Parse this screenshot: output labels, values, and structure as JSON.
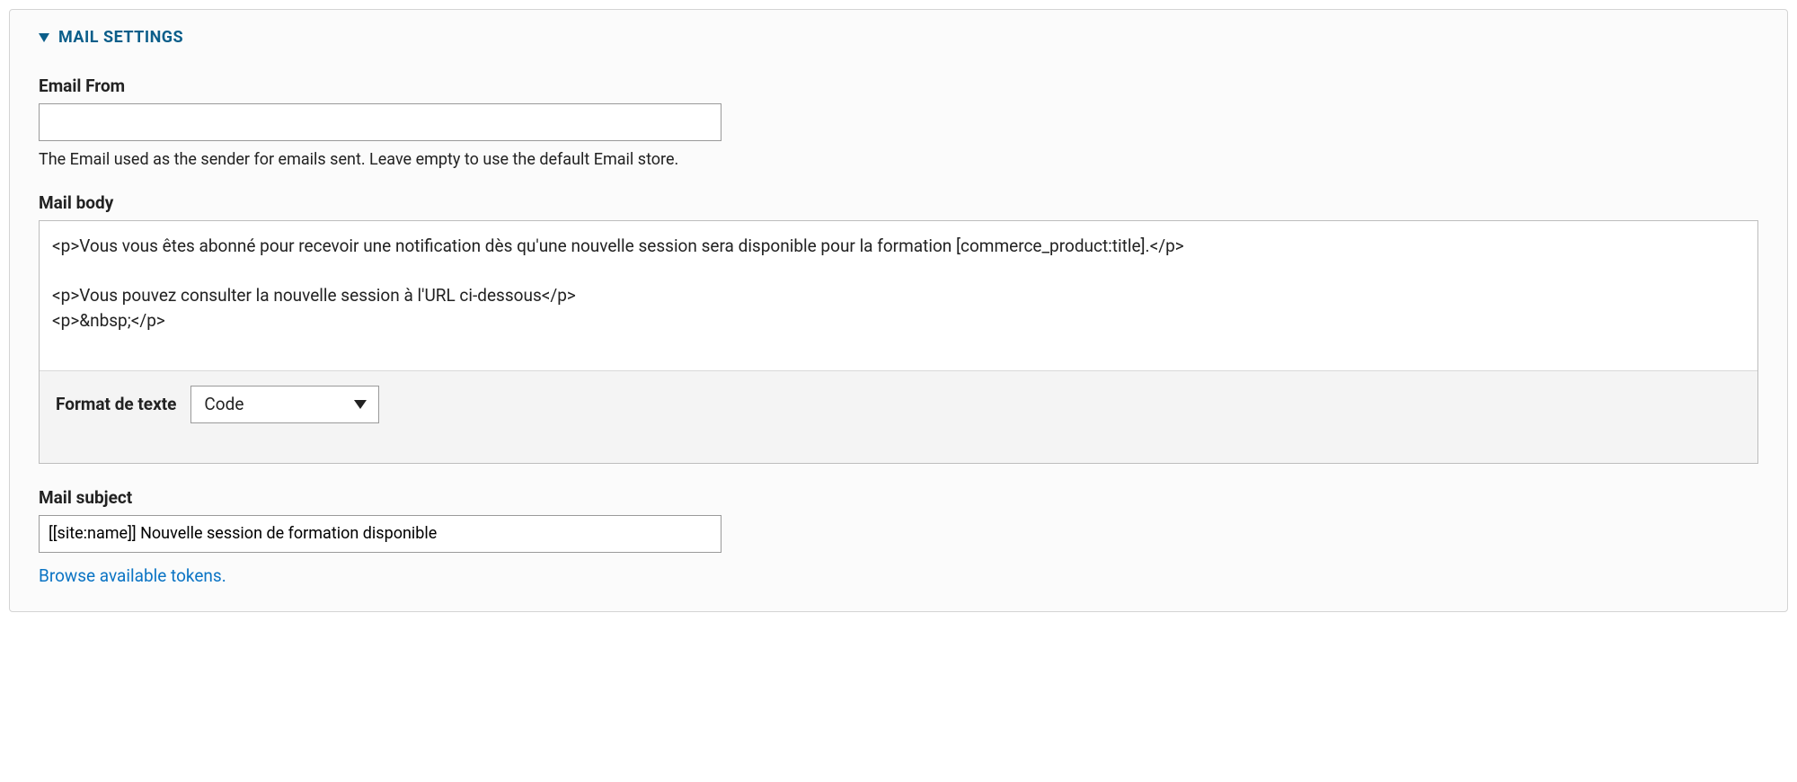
{
  "fieldset": {
    "legend": "MAIL SETTINGS"
  },
  "emailFrom": {
    "label": "Email From",
    "value": "",
    "help": "The Email used as the sender for emails sent. Leave empty to use the default Email store."
  },
  "mailBody": {
    "label": "Mail body",
    "value": "<p>Vous vous êtes abonné pour recevoir une notification dès qu'une nouvelle session sera disponible pour la formation [commerce_product:title].</p>\n\n<p>Vous pouvez consulter la nouvelle session à l'URL ci-dessous</p>\n<p>&nbsp;</p>"
  },
  "textFormat": {
    "label": "Format de texte",
    "selected": "Code"
  },
  "mailSubject": {
    "label": "Mail subject",
    "value": "[[site:name]] Nouvelle session de formation disponible"
  },
  "tokensLink": {
    "text": "Browse available tokens."
  }
}
